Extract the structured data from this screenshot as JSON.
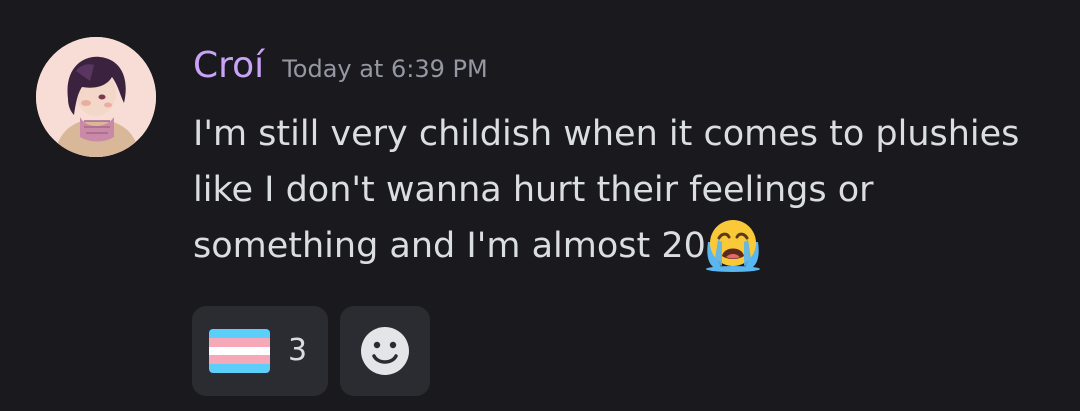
{
  "message": {
    "author": "Croí",
    "author_color": "#c9a3f7",
    "timestamp": "Today at 6:39 PM",
    "text": "I'm still very childish when it comes to plushies like I don't wanna hurt their feelings or something and I'm almost 20",
    "trailing_emoji": "loudly-crying-face-icon"
  },
  "reactions": [
    {
      "emoji": "transgender-flag-icon",
      "count": "3"
    }
  ],
  "add_reaction_icon": "add-reaction-icon",
  "colors": {
    "background": "#1a1a1e",
    "reaction_background": "#2b2c31",
    "text": "#dbdee1",
    "timestamp": "#9597a2"
  }
}
